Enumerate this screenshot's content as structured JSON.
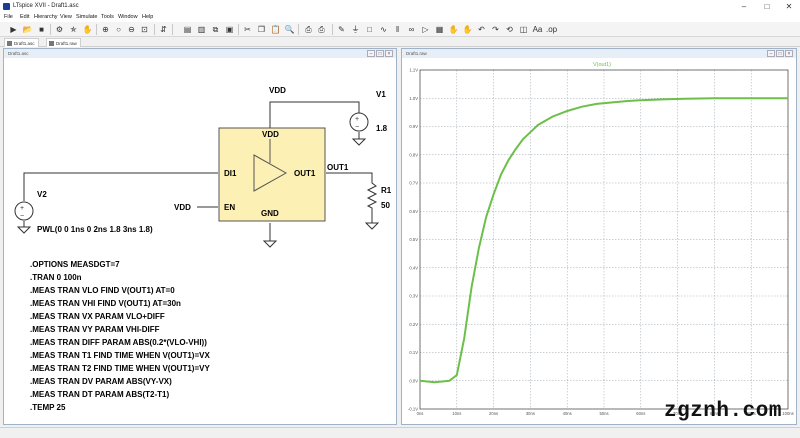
{
  "window": {
    "title": "LTspice XVII - Draft1.asc"
  },
  "menu": {
    "items": [
      "File",
      "Edit",
      "Hierarchy",
      "View",
      "Simulate",
      "Tools",
      "Window",
      "Help"
    ]
  },
  "tabs": [
    {
      "label": "Draft1.asc"
    },
    {
      "label": "Draft1.raw"
    }
  ],
  "schematic": {
    "title": "Draft1.asc",
    "labels": {
      "vdd_top": "VDD",
      "v1_name": "V1",
      "v1_value": "1.8",
      "block_vdd": "VDD",
      "block_di1": "DI1",
      "block_out1": "OUT1",
      "block_en": "EN",
      "block_gnd": "GND",
      "vdd_en": "VDD",
      "out1_net": "OUT1",
      "r1_name": "R1",
      "r1_value": "50",
      "v2_name": "V2",
      "v2_value": "PWL(0 0 1ns 0 2ns 1.8 3ns 1.8)"
    },
    "directives": [
      ".OPTIONS MEASDGT=7",
      ".TRAN 0 100n",
      ".MEAS TRAN VLO FIND V(OUT1) AT=0",
      ".MEAS TRAN VHI FIND V(OUT1) AT=30n",
      ".MEAS TRAN VX PARAM VLO+DIFF",
      ".MEAS TRAN VY PARAM VHI-DIFF",
      ".MEAS TRAN DIFF PARAM ABS(0.2*(VLO-VHI))",
      ".MEAS TRAN T1 FIND TIME WHEN V(OUT1)=VX",
      ".MEAS TRAN T2  FIND TIME WHEN V(OUT1)=VY",
      ".MEAS TRAN DV PARAM ABS(VY-VX)",
      ".MEAS TRAN DT PARAM ABS(T2-T1)",
      ".TEMP 25"
    ]
  },
  "waveform": {
    "title": "Draft1.raw",
    "trace_color": "#6cc04a"
  },
  "chart_data": {
    "type": "line",
    "title": "V(out1)",
    "xlabel": "",
    "ylabel": "",
    "xunit": "ns",
    "yunit": "V",
    "xlim": [
      0,
      100
    ],
    "ylim": [
      -0.1,
      1.1
    ],
    "x_ticks": [
      "0ns",
      "10ns",
      "20ns",
      "30ns",
      "40ns",
      "50ns",
      "60ns",
      "70ns",
      "80ns",
      "90ns",
      "100ns"
    ],
    "y_ticks": [
      "-0.1V",
      "0.0V",
      "0.1V",
      "0.2V",
      "0.3V",
      "0.4V",
      "0.5V",
      "0.6V",
      "0.7V",
      "0.8V",
      "0.9V",
      "1.0V",
      "1.1V"
    ],
    "grid": true,
    "series": [
      {
        "name": "V(out1)",
        "x": [
          0,
          4,
          8,
          10,
          12,
          14,
          16,
          18,
          20,
          22,
          24,
          26,
          28,
          30,
          32,
          34,
          36,
          38,
          40,
          44,
          48,
          52,
          56,
          60,
          66,
          72,
          80,
          90,
          100
        ],
        "y": [
          0.0,
          -0.005,
          0.0,
          0.02,
          0.15,
          0.33,
          0.47,
          0.58,
          0.66,
          0.73,
          0.78,
          0.82,
          0.855,
          0.88,
          0.905,
          0.92,
          0.935,
          0.945,
          0.955,
          0.97,
          0.98,
          0.985,
          0.99,
          0.993,
          0.996,
          0.998,
          1.0,
          1.0,
          1.0
        ]
      }
    ]
  },
  "watermark": "zgznh.com"
}
